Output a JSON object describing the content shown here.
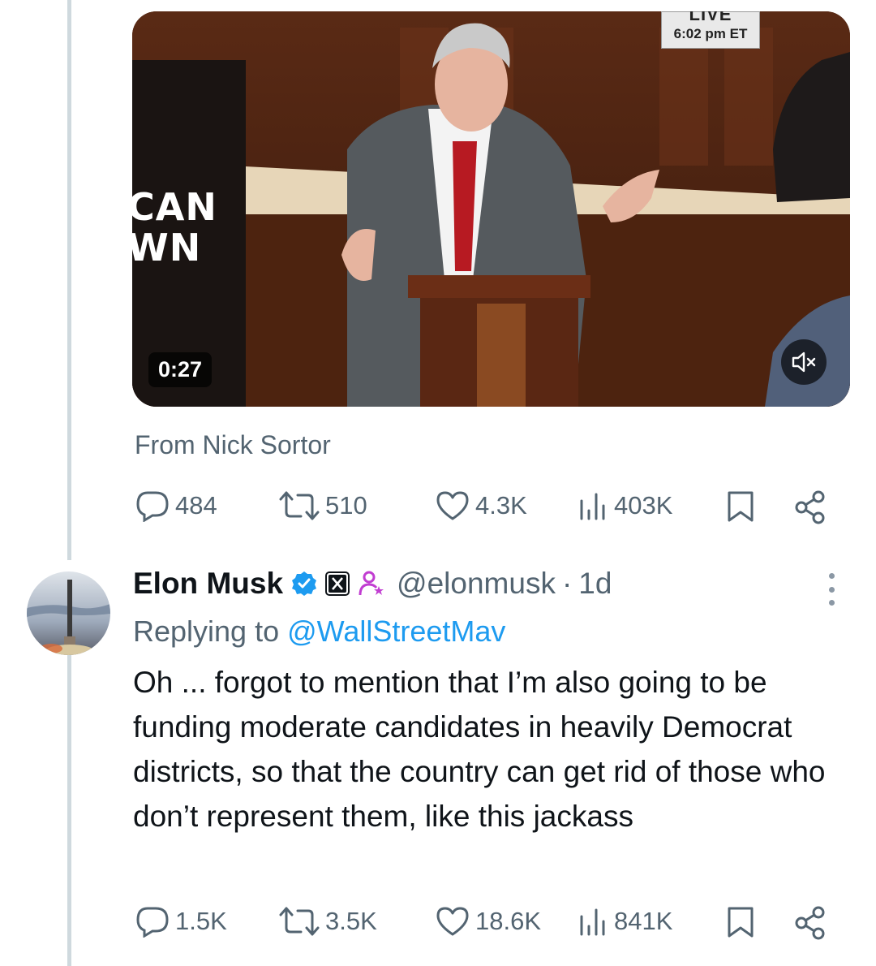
{
  "video": {
    "live_label": "LIVE",
    "live_time": "6:02 pm ET",
    "overlay_text_line1": "CAN",
    "overlay_text_line2": "WN",
    "duration": "0:27"
  },
  "source_label": "From Nick Sortor",
  "quoted_stats": {
    "replies": "484",
    "reposts": "510",
    "likes": "4.3K",
    "views": "403K"
  },
  "reply": {
    "display_name": "Elon Musk",
    "handle": "@elonmusk",
    "separator": "·",
    "time": "1d",
    "replying_prefix": "Replying to",
    "replying_to": "@WallStreetMav",
    "text": "Oh ... forgot to mention that I’m also going to be funding moderate candidates in heavily Democrat districts, so that the country can get rid of those who don’t represent them, like this jackass",
    "stats": {
      "replies": "1.5K",
      "reposts": "3.5K",
      "likes": "18.6K",
      "views": "841K"
    }
  },
  "colors": {
    "secondary_text": "#536471",
    "link": "#1d9bf0",
    "verified": "#1d9bf0",
    "affiliate_pink": "#c13dd1",
    "thread_line": "#cfd9de"
  },
  "icons": [
    "reply-icon",
    "repost-icon",
    "like-icon",
    "views-icon",
    "bookmark-icon",
    "share-icon",
    "mute-icon",
    "verified-icon",
    "x-affiliate-icon",
    "person-icon",
    "more-icon"
  ]
}
